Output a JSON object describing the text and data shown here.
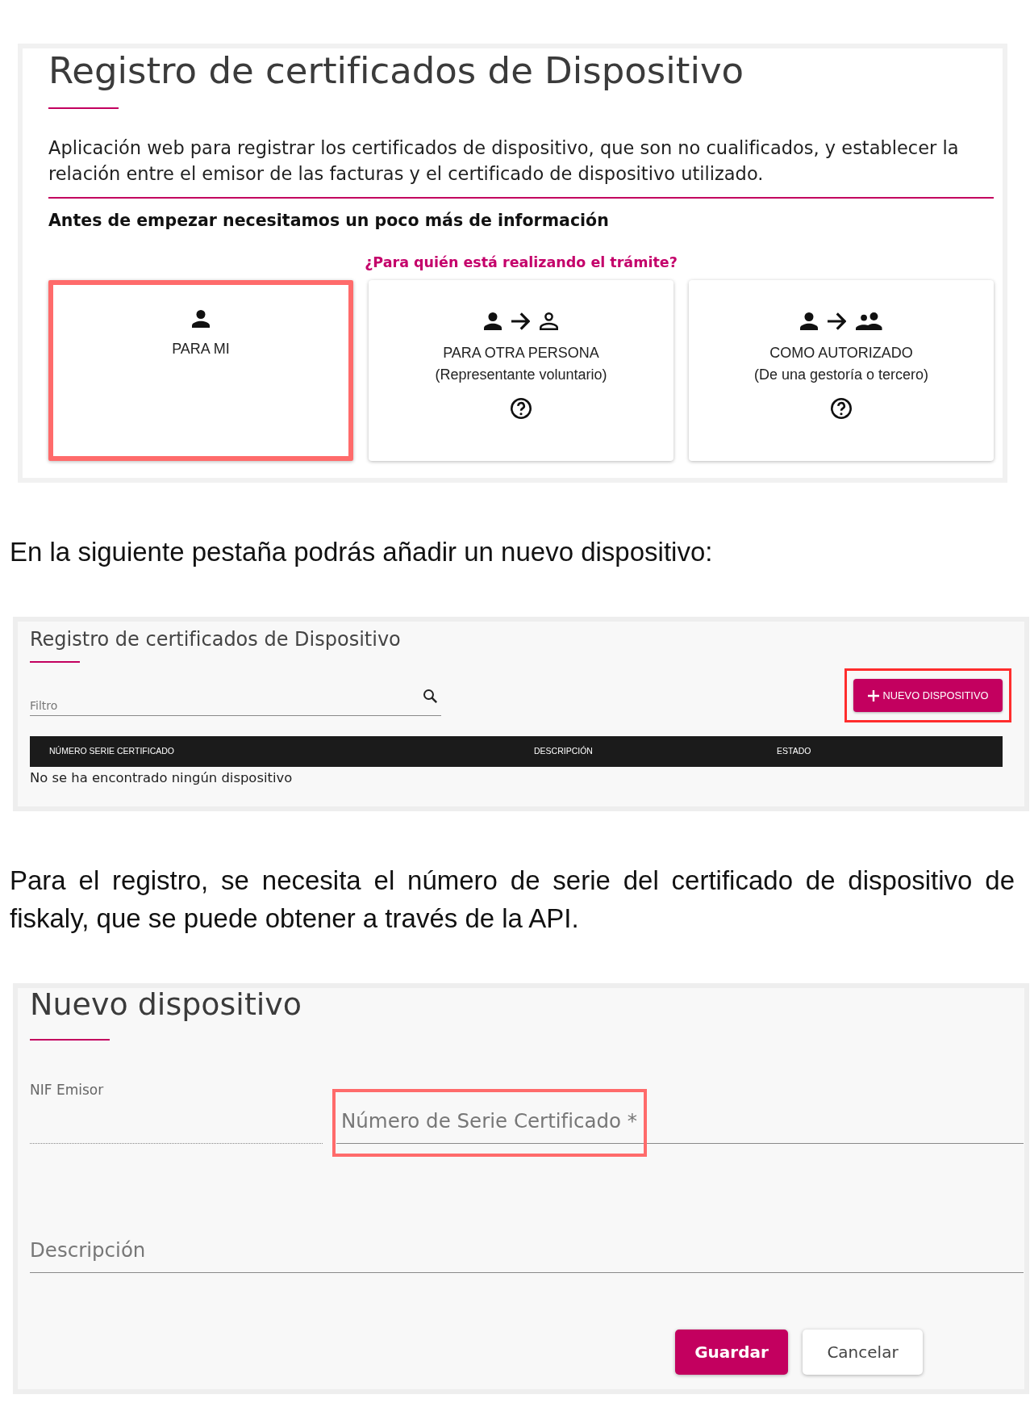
{
  "intro_panel": {
    "title": "Registro de certificados de Dispositivo",
    "description": "Aplicación web para registrar los certificados de dispositivo, que son no cualificados, y establecer la relación entre el emisor de las facturas y el certificado de dispositivo utilizado.",
    "prompt": "Antes de empezar necesitamos un poco más de información",
    "question": "¿Para quién está realizando el trámite?",
    "options": [
      {
        "kind": "self",
        "label": "PARA MI",
        "help": false,
        "highlighted": true
      },
      {
        "kind": "representative",
        "label": "PARA OTRA PERSONA",
        "sublabel": "(Representante voluntario)",
        "help": true,
        "highlighted": false
      },
      {
        "kind": "authorized",
        "label": "COMO AUTORIZADO",
        "sublabel": "(De una gestoría o tercero)",
        "help": true,
        "highlighted": false
      }
    ]
  },
  "step_text": "En la siguiente pestaña podrás añadir un nuevo dispositivo:",
  "device_list_panel": {
    "title": "Registro de certificados de Dispositivo",
    "filter": {
      "placeholder": "Filtro"
    },
    "new_button": {
      "label": "NUEVO DISPOSITIVO",
      "highlighted": true
    },
    "table": {
      "columns": [
        "NÚMERO SERIE CERTIFICADO",
        "DESCRIPCIÓN",
        "ESTADO"
      ],
      "empty_message": "No se ha encontrado ningún dispositivo"
    }
  },
  "note_text": "Para el registro, se necesita el número de serie del certificado de dispositivo de fiskaly, que se puede obtener a través de la API.",
  "form_panel": {
    "title": "Nuevo dispositivo",
    "fields": [
      {
        "label": "NIF Emisor",
        "disabled": true,
        "highlighted": false
      },
      {
        "placeholder": "Número de Serie Certificado *",
        "disabled": false,
        "highlighted": true
      },
      {
        "placeholder": "Descripción",
        "disabled": false,
        "highlighted": false
      }
    ],
    "buttons": [
      {
        "kind": "primary",
        "label": "Guardar"
      },
      {
        "kind": "secondary",
        "label": "Cancelar"
      }
    ]
  }
}
